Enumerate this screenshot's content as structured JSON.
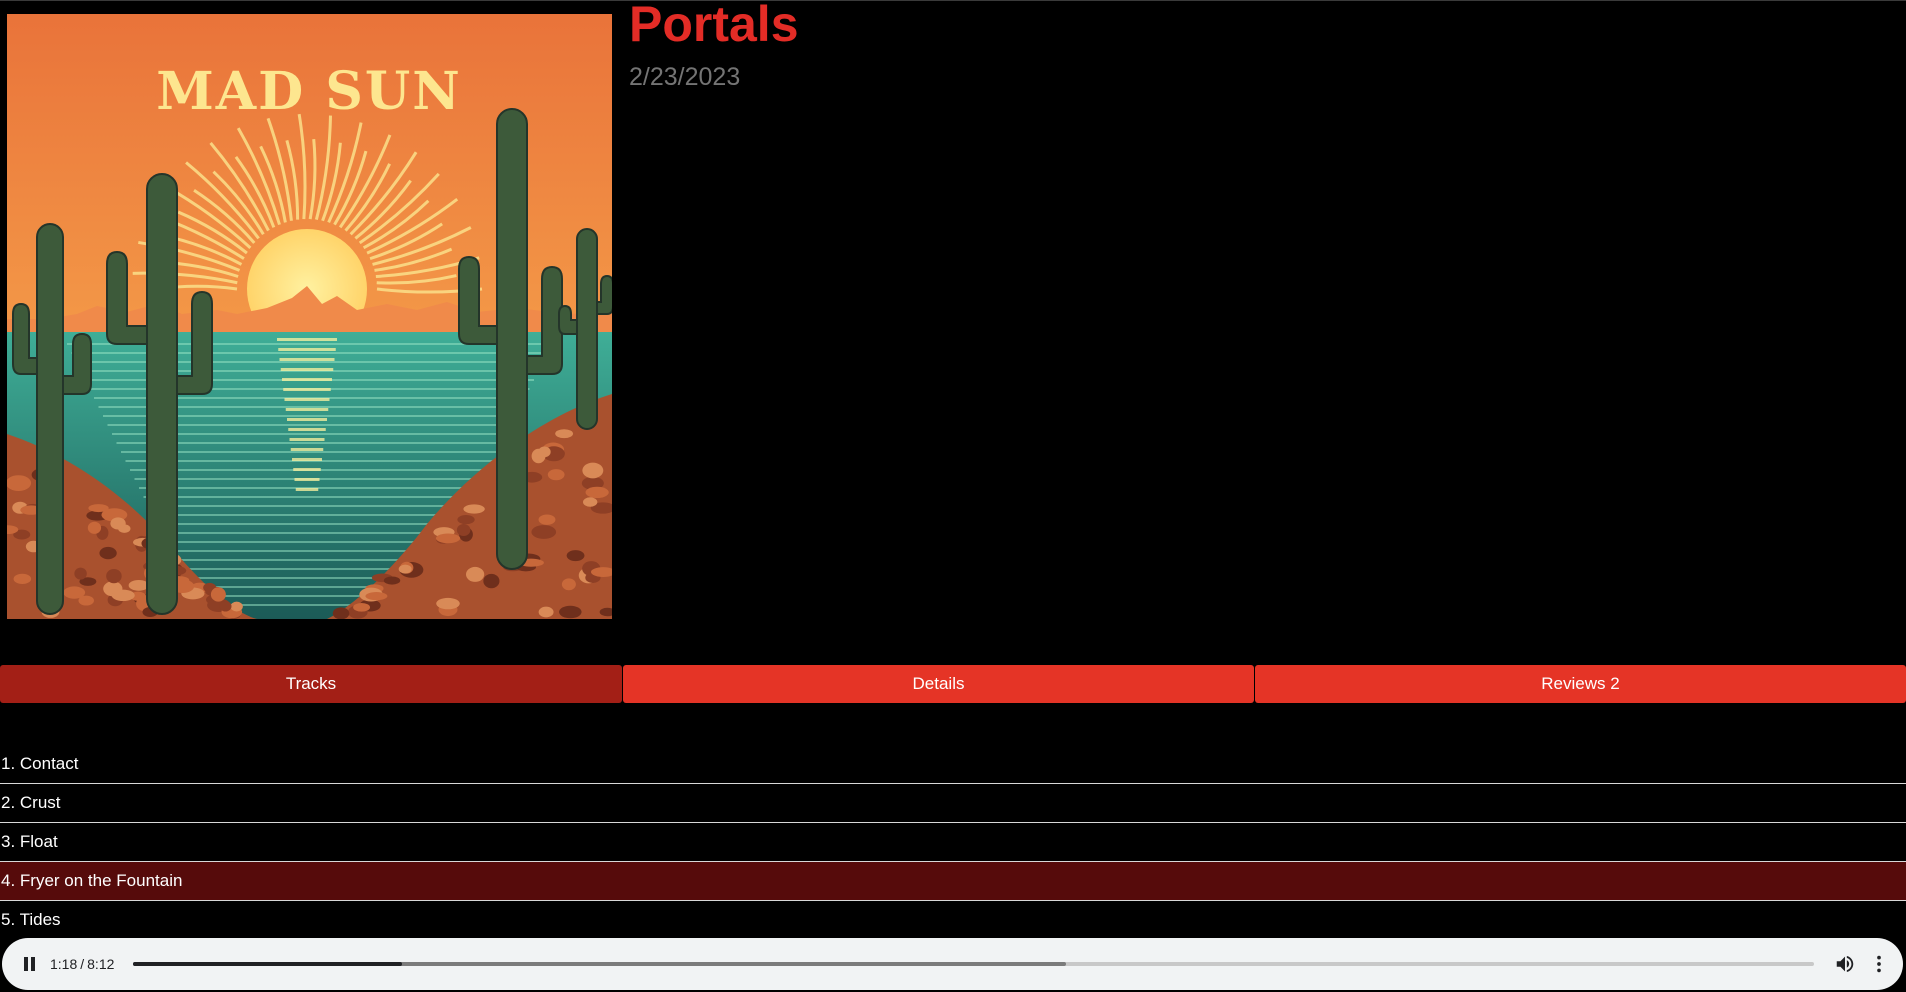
{
  "album": {
    "title": "Portals",
    "date": "2/23/2023",
    "cover_text": "MAD SUN"
  },
  "tabs": [
    {
      "label": "Tracks",
      "selected": true
    },
    {
      "label": "Details",
      "selected": false
    },
    {
      "label": "Reviews 2",
      "selected": false
    }
  ],
  "tracks": [
    {
      "label": "1. Contact",
      "active": false
    },
    {
      "label": "2. Crust",
      "active": false
    },
    {
      "label": "3. Float",
      "active": false
    },
    {
      "label": "4. Fryer on the Fountain",
      "active": true
    },
    {
      "label": "5. Tides",
      "active": false
    }
  ],
  "player": {
    "current_time": "1:18",
    "separator": "/",
    "duration": "8:12",
    "played_fraction": 0.16,
    "buffered_fraction": 0.555,
    "state": "playing",
    "icons": [
      "pause-icon",
      "volume-icon",
      "more-vert-icon"
    ]
  },
  "colors": {
    "accent": "#e32c26",
    "tab_selected": "#a31f16",
    "tab": "#e53426",
    "track_active": "#560b0b",
    "date": "#747474",
    "player_bg": "#f1f3f4"
  }
}
